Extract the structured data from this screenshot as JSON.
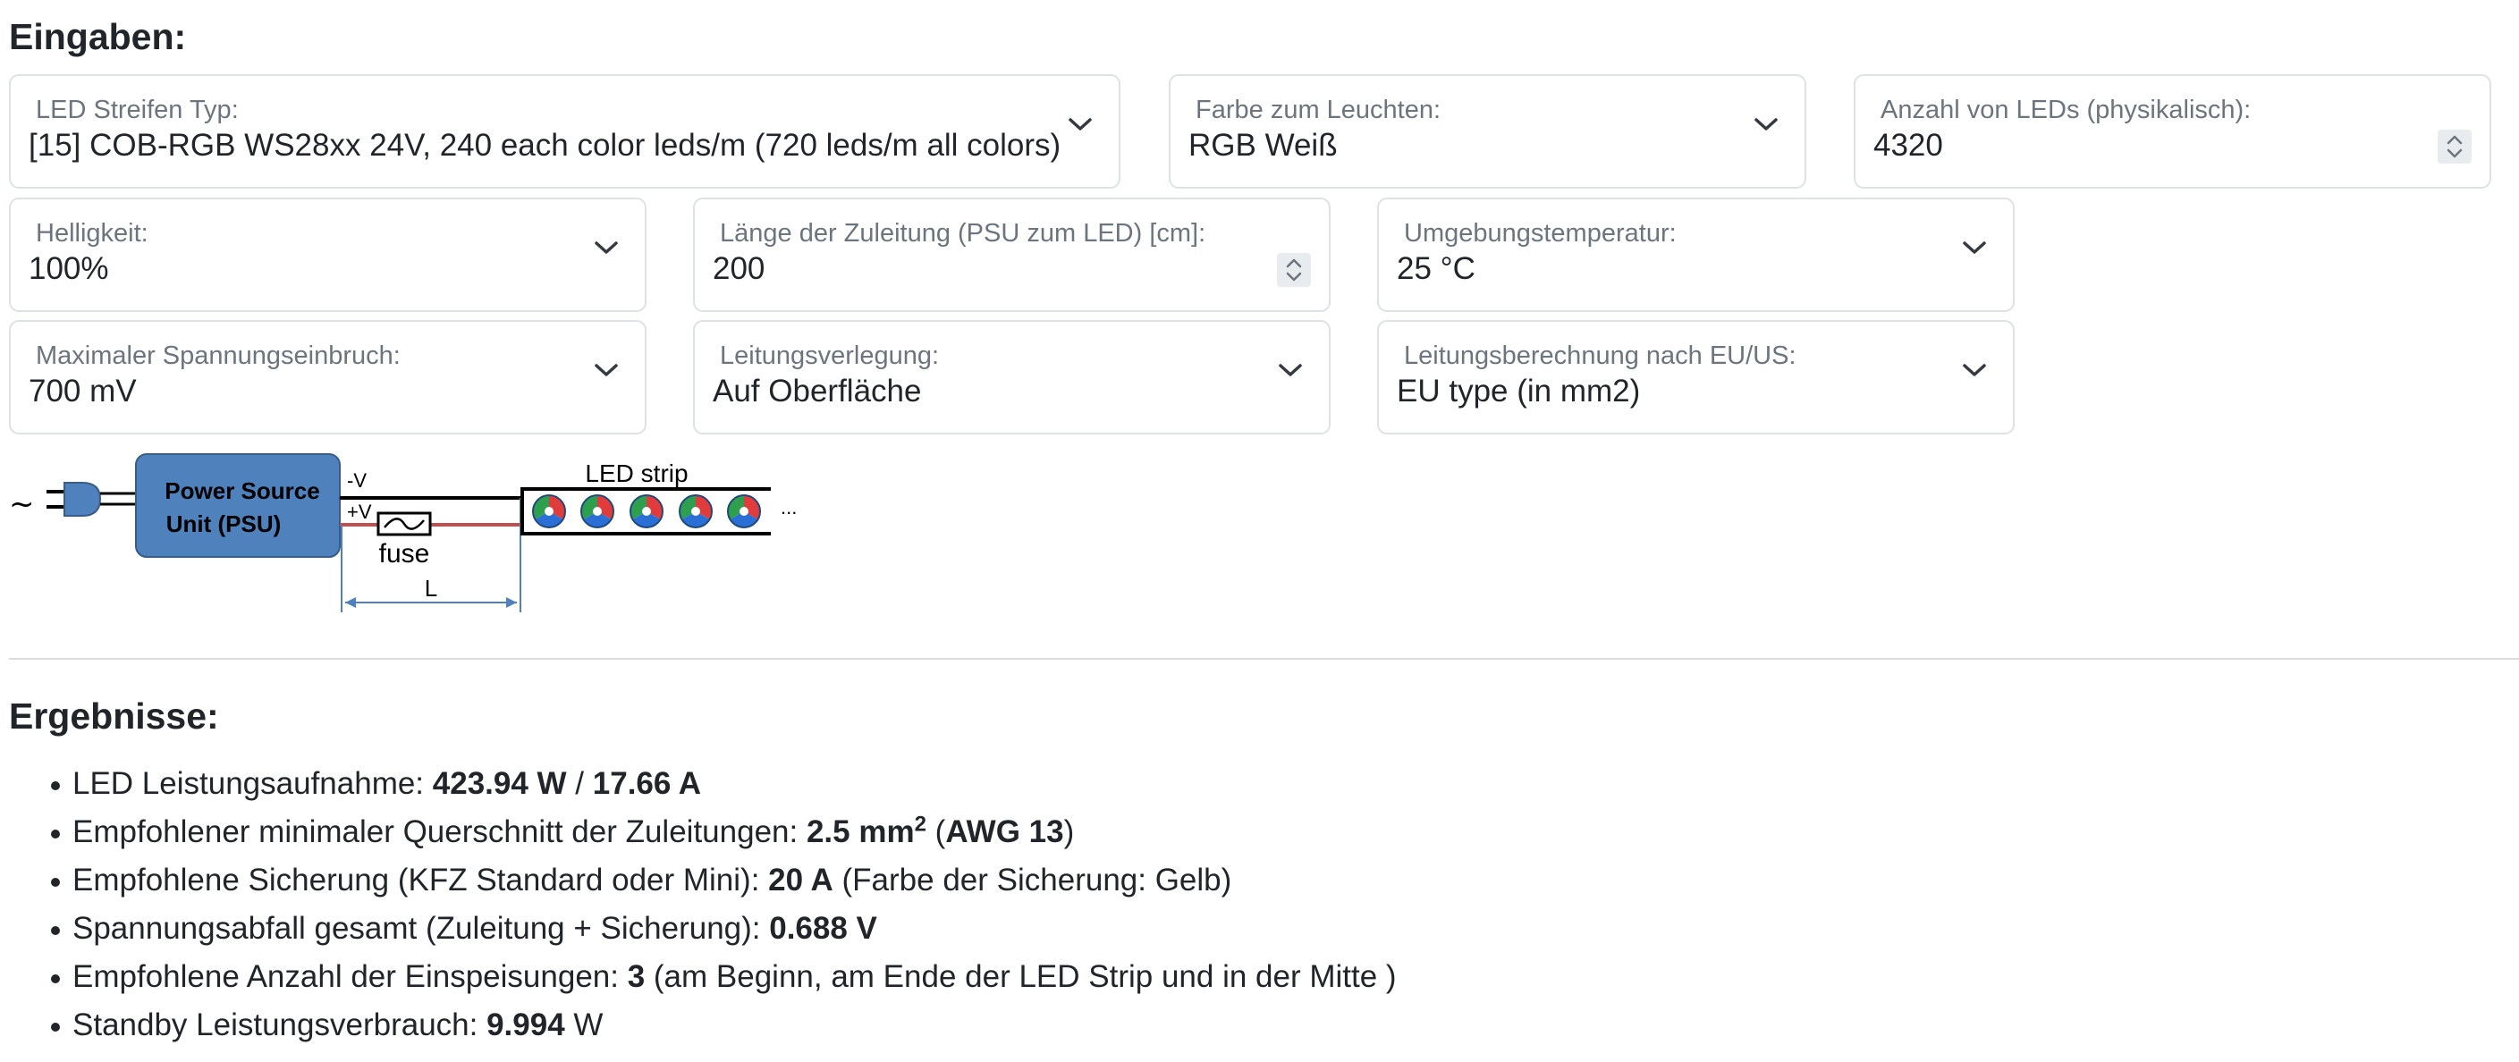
{
  "inputs": {
    "heading": "Eingaben:",
    "led_type": {
      "label": "LED Streifen Typ:",
      "value": "[15] COB-RGB WS28xx 24V, 240 each color leds/m (720 leds/m all colors)"
    },
    "color": {
      "label": "Farbe zum Leuchten:",
      "value": "RGB Weiß"
    },
    "led_count": {
      "label": "Anzahl von LEDs (physikalisch):",
      "value": "4320"
    },
    "brightness": {
      "label": "Helligkeit:",
      "value": "100%"
    },
    "lead_length": {
      "label": "Länge der Zuleitung (PSU zum LED) [cm]:",
      "value": "200"
    },
    "ambient_temp": {
      "label": "Umgebungstemperatur:",
      "value": "25 °C"
    },
    "max_voltage_drop": {
      "label": "Maximaler Spannungseinbruch:",
      "value": "700 mV"
    },
    "cable_routing": {
      "label": "Leitungsverlegung:",
      "value": "Auf Oberfläche"
    },
    "cable_calc": {
      "label": "Leitungsberechnung nach EU/US:",
      "value": "EU type (in mm2)"
    }
  },
  "diagram": {
    "tilde": "~",
    "psu_line1": "Power Source",
    "psu_line2": "Unit (PSU)",
    "minus_v": "-V",
    "plus_v": "+V",
    "fuse": "fuse",
    "length": "L",
    "strip": "LED strip",
    "ellipsis": "..."
  },
  "results": {
    "heading": "Ergebnisse:",
    "r1": {
      "label": "LED Leistungsaufnahme: ",
      "power": "423.94 W",
      "sep": " / ",
      "current": "17.66 A"
    },
    "r2": {
      "label": "Empfohlener minimaler Querschnitt der Zuleitungen: ",
      "value": "2.5 mm",
      "sup": "2",
      "open": " (",
      "awg": "AWG 13",
      "close": ")"
    },
    "r3": {
      "label": "Empfohlene Sicherung (KFZ Standard oder Mini): ",
      "value": "20 A",
      "note": " (Farbe der Sicherung: Gelb)"
    },
    "r4": {
      "label": "Spannungsabfall gesamt (Zuleitung + Sicherung): ",
      "value": "0.688 V"
    },
    "r5": {
      "label": "Empfohlene Anzahl der Einspeisungen: ",
      "value": "3",
      "note": " (am Beginn, am Ende der LED Strip und in der Mitte )"
    },
    "r6": {
      "label": "Standby Leistungsverbrauch: ",
      "value": "9.994",
      "unit": " W"
    }
  },
  "colors": {
    "psu_fill": "#4f81bd",
    "wire_plus": "#c0504d",
    "dim_line": "#4f81bd"
  }
}
